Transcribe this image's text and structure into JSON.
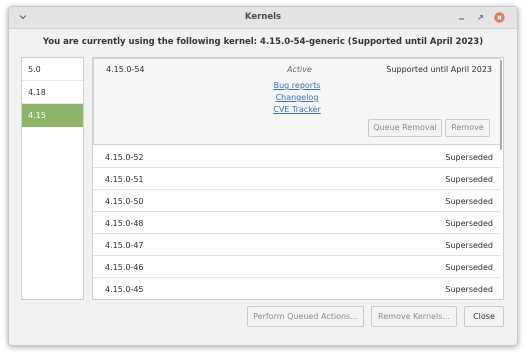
{
  "window": {
    "title": "Kernels"
  },
  "heading": "You are currently using the following kernel: 4.15.0-54-generic (Supported until April 2023)",
  "sidebar": {
    "items": [
      {
        "label": "5.0"
      },
      {
        "label": "4.18"
      },
      {
        "label": "4.15"
      }
    ],
    "selected": "4.15"
  },
  "active": {
    "version": "4.15.0-54",
    "status": "Active",
    "support": "Supported until April 2023",
    "links": [
      "Bug reports",
      "Changelog",
      "CVE Tracker"
    ],
    "queue_label": "Queue Removal",
    "remove_label": "Remove"
  },
  "kernels": [
    {
      "version": "4.15.0-52",
      "status": "Superseded"
    },
    {
      "version": "4.15.0-51",
      "status": "Superseded"
    },
    {
      "version": "4.15.0-50",
      "status": "Superseded"
    },
    {
      "version": "4.15.0-48",
      "status": "Superseded"
    },
    {
      "version": "4.15.0-47",
      "status": "Superseded"
    },
    {
      "version": "4.15.0-46",
      "status": "Superseded"
    },
    {
      "version": "4.15.0-45",
      "status": "Superseded"
    }
  ],
  "buttons": {
    "perform_queued": "Perform Queued Actions...",
    "remove_kernels": "Remove Kernels...",
    "close": "Close"
  },
  "colors": {
    "selection": "#8db56a",
    "link": "#3b6fb6",
    "close_icon": "#e07c5b"
  }
}
